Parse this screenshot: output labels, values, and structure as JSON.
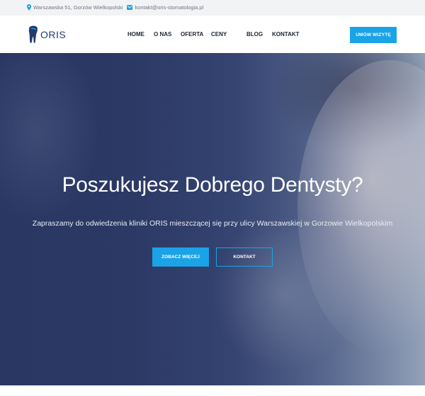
{
  "topbar": {
    "address": "Warszawska 51, Gorzów Wielkopolski",
    "email": "kontakt@oris-stomatologia.pl",
    "address_icon": "location-pin-icon",
    "email_icon": "envelope-icon"
  },
  "logo": {
    "text": "ORIS",
    "icon": "tooth-icon"
  },
  "nav": {
    "items": [
      "HOME",
      "O NAS",
      "OFERTA",
      "CENY",
      "BLOG",
      "KONTAKT"
    ]
  },
  "header": {
    "cta_label": "UMÓW WIZYTĘ"
  },
  "hero": {
    "title": "Poszukujesz Dobrego Dentysty?",
    "subtitle": "Zapraszamy do odwiedzenia kliniki ORIS mieszczącej się przy ulicy Warszawskiej w Gorzowie Wielkopolskim",
    "primary_button": "ZOBACZ WIĘCEJ",
    "secondary_button": "KONTAKT"
  },
  "colors": {
    "accent": "#1aa3e6",
    "hero_overlay": "#2d3b67",
    "nav_text": "#1e2533",
    "logo": "#233b6e"
  }
}
